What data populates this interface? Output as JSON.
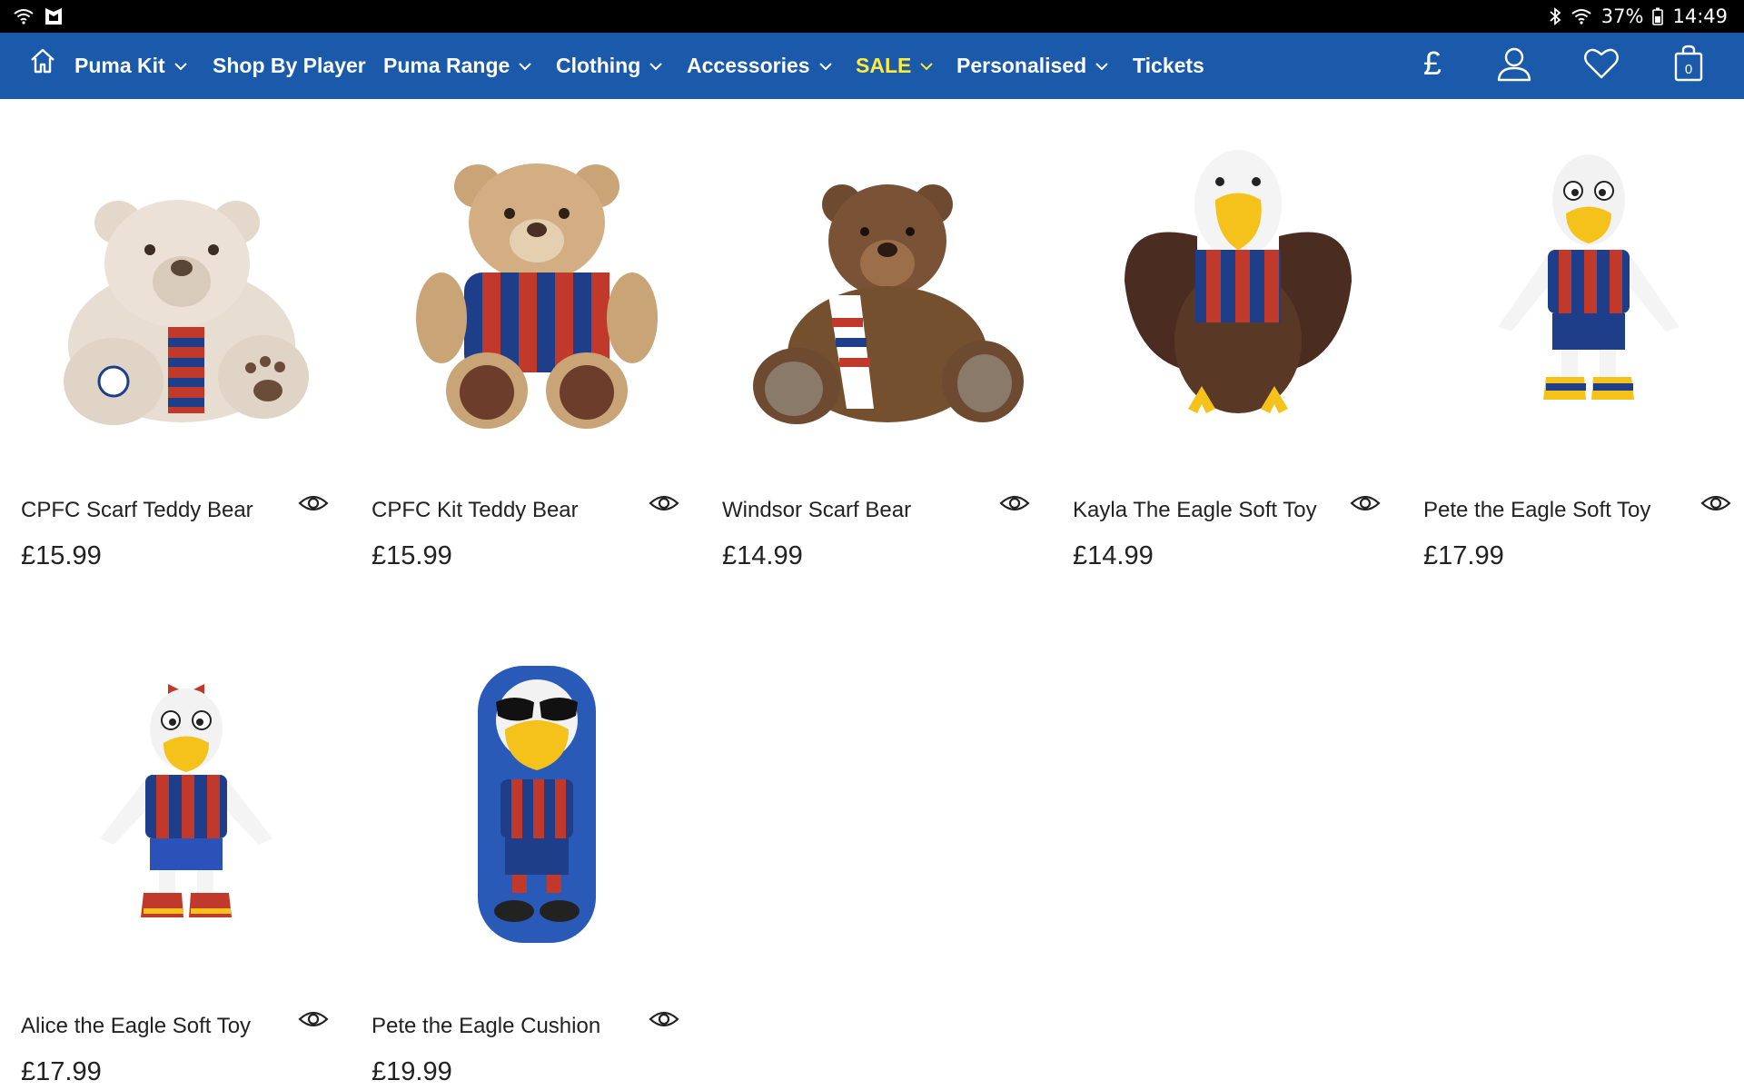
{
  "status_bar": {
    "battery": "37%",
    "time": "14:49",
    "icons": [
      "wifi-icon",
      "shield-app-icon",
      "bluetooth-icon",
      "wifi-signal-icon",
      "battery-icon"
    ]
  },
  "nav": {
    "home_icon": "home-icon",
    "items": [
      {
        "label": "Puma Kit",
        "has_dropdown": true
      },
      {
        "label": "Shop By Player",
        "has_dropdown": false
      },
      {
        "label": "Puma Range",
        "has_dropdown": true
      },
      {
        "label": "Clothing",
        "has_dropdown": true
      },
      {
        "label": "Accessories",
        "has_dropdown": true
      },
      {
        "label": "SALE",
        "has_dropdown": true
      },
      {
        "label": "Personalised",
        "has_dropdown": true
      },
      {
        "label": "Tickets",
        "has_dropdown": false
      }
    ],
    "currency": "£",
    "basket_count": "0",
    "colors": {
      "bar": "#1b5aaa",
      "sale": "#ffeb3b"
    }
  },
  "products": [
    {
      "name": "CPFC Scarf Teddy Bear",
      "price": "£15.99",
      "image": "cream-teddy-bear-with-scarf"
    },
    {
      "name": "CPFC Kit Teddy Bear",
      "price": "£15.99",
      "image": "teddy-bear-in-kit"
    },
    {
      "name": "Windsor Scarf Bear",
      "price": "£14.99",
      "image": "brown-bear-with-scarf"
    },
    {
      "name": "Kayla The Eagle Soft Toy",
      "price": "£14.99",
      "image": "eagle-soft-toy"
    },
    {
      "name": "Pete the Eagle Soft Toy",
      "price": "£17.99",
      "image": "eagle-mascot-soft-toy"
    },
    {
      "name": "Alice the Eagle Soft Toy",
      "price": "£17.99",
      "image": "eagle-mascot-with-bow"
    },
    {
      "name": "Pete the Eagle Cushion",
      "price": "£19.99",
      "image": "eagle-cushion"
    }
  ]
}
